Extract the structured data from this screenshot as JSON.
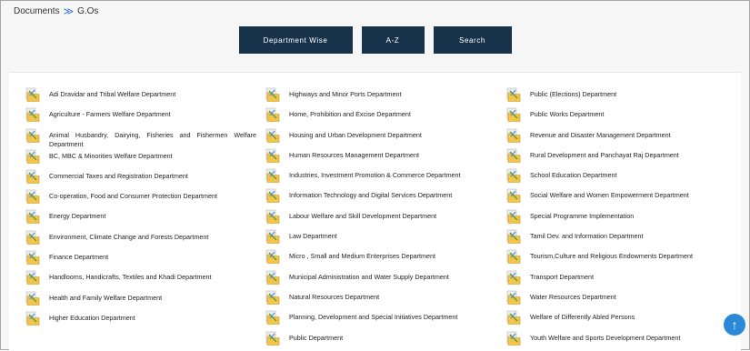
{
  "breadcrumb": {
    "root": "Documents",
    "separator": "≫",
    "current": "G.Os"
  },
  "toolbar": {
    "department_wise": "Department Wise",
    "a_z": "A-Z",
    "search": "Search"
  },
  "colors": {
    "button_bg": "#18324a",
    "link_blue": "#2f6fd0",
    "scroll_top_bg": "#2a8ad8"
  },
  "scroll_top_icon": "arrow-up-icon",
  "departments": {
    "col1": [
      "Adi Dravidar and Tribal Welfare Department",
      "Agriculture - Farmers Welfare Department",
      "Animal Husbandry, Dairying, Fisheries and Fishermen Welfare Department",
      "BC, MBC & Minorities Welfare Department",
      "Commercial Taxes and Registration Department",
      "Co-operation, Food and Consumer Protection Department",
      "Energy Department",
      "Environment, Climate Change and Forests Department",
      "Finance Department",
      "Handlooms, Handicrafts, Textiles and Khadi Department",
      "Health and Family Welfare Department",
      "Higher Education Department"
    ],
    "col2": [
      "Highways and Minor Ports Department",
      "Home, Prohibition and Excise Department",
      "Housing and Urban Development Department",
      "Human Resources Management Department",
      "Industries, Investment Promotion & Commerce Department",
      "Information Technology and Digital Services Department",
      "Labour Welfare and Skill Development Department",
      "Law Department",
      "Micro , Small and Medium Enterprises Department",
      "Municipal Administration and Water Supply Department",
      "Natural Resources Department",
      "Planning, Development and Special Initiatives Department",
      "Public Department"
    ],
    "col3": [
      "Public (Elections) Department",
      "Public Works Department",
      "Revenue and Disaster Management Department",
      "Rural Development and Panchayat Raj Department",
      "School Education Department",
      "Social Welfare and Women Empowerment Department",
      "Special Programme Implementation",
      "Tamil Dev. and Information Department",
      "Tourism,Culture and Religious Endowments Department",
      "Transport Department",
      "Water Resources Department",
      "Welfare of Differently Abled Persons",
      "Youth Welfare and Sports Development Department"
    ]
  }
}
